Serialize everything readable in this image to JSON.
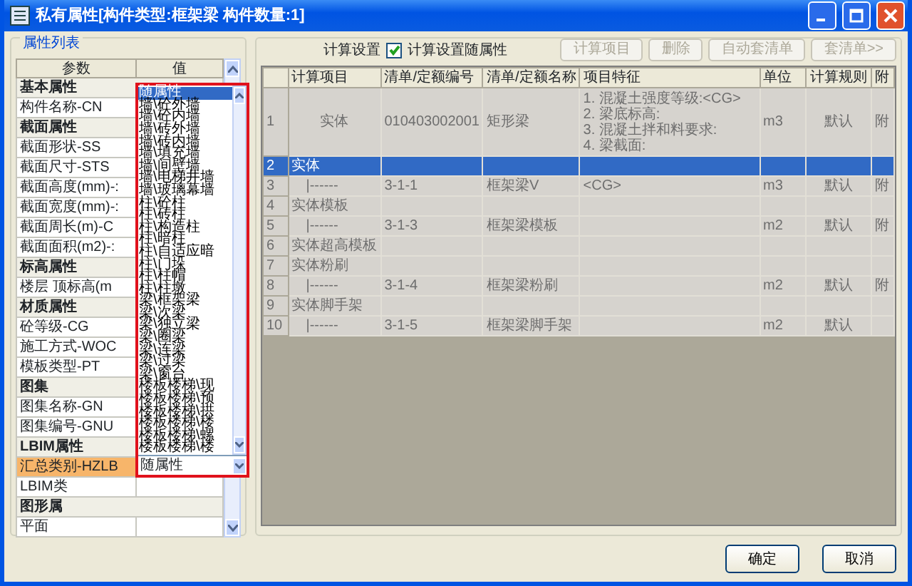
{
  "window": {
    "title": "私有属性[构件类型:框架梁 构件数量:1]"
  },
  "property_list": {
    "title": "属性列表",
    "columns": [
      "参数",
      "值"
    ],
    "rows": [
      {
        "kind": "group",
        "label": "基本属性"
      },
      {
        "kind": "param",
        "label": "构件名称-CN",
        "selected": false
      },
      {
        "kind": "group",
        "label": "截面属性"
      },
      {
        "kind": "param",
        "label": "截面形状-SS",
        "selected": false
      },
      {
        "kind": "param",
        "label": "截面尺寸-STS",
        "selected": false
      },
      {
        "kind": "param",
        "label": "截面高度(mm)-:",
        "selected": false
      },
      {
        "kind": "param",
        "label": "截面宽度(mm)-:",
        "selected": false
      },
      {
        "kind": "param",
        "label": "截面周长(m)-C",
        "selected": false
      },
      {
        "kind": "param",
        "label": "截面面积(m2)-:",
        "selected": false
      },
      {
        "kind": "group",
        "label": "标高属性"
      },
      {
        "kind": "param",
        "label": "楼层 顶标高(m",
        "selected": false
      },
      {
        "kind": "group",
        "label": "材质属性"
      },
      {
        "kind": "param",
        "label": "砼等级-CG",
        "selected": false
      },
      {
        "kind": "param",
        "label": "施工方式-WOC",
        "selected": false
      },
      {
        "kind": "param",
        "label": "模板类型-PT",
        "selected": false
      },
      {
        "kind": "group",
        "label": "图集"
      },
      {
        "kind": "param",
        "label": "图集名称-GN",
        "selected": false
      },
      {
        "kind": "param",
        "label": "图集编号-GNU",
        "selected": false
      },
      {
        "kind": "group",
        "label": "LBIM属性"
      },
      {
        "kind": "param",
        "label": "汇总类别-HZLB",
        "selected": true,
        "dropdown": true
      },
      {
        "kind": "param",
        "label": "LBIM类",
        "selected": false
      },
      {
        "kind": "group",
        "label": "图形属"
      },
      {
        "kind": "param",
        "label": "平面",
        "selected": false
      }
    ],
    "dropdown": {
      "value": "随属性",
      "options": [
        {
          "label": "随属性",
          "selected": true
        },
        {
          "label": "墙\\砼外墙",
          "selected": false
        },
        {
          "label": "墙\\砼内墙",
          "selected": false
        },
        {
          "label": "墙\\砖外墙",
          "selected": false
        },
        {
          "label": "墙\\砖内墙",
          "selected": false
        },
        {
          "label": "墙\\填充墙",
          "selected": false
        },
        {
          "label": "墙\\间壁墙",
          "selected": false
        },
        {
          "label": "墙\\电梯井墙",
          "selected": false
        },
        {
          "label": "墙\\玻璃幕墙",
          "selected": false
        },
        {
          "label": "柱\\砼柱",
          "selected": false
        },
        {
          "label": "柱\\砖柱",
          "selected": false
        },
        {
          "label": "柱\\构造柱",
          "selected": false
        },
        {
          "label": "柱\\暗柱",
          "selected": false
        },
        {
          "label": "柱\\自适应暗",
          "selected": false
        },
        {
          "label": "柱\\门垛",
          "selected": false
        },
        {
          "label": "柱\\柱帽",
          "selected": false
        },
        {
          "label": "柱\\柱墩",
          "selected": false
        },
        {
          "label": "梁\\框架梁",
          "selected": false
        },
        {
          "label": "梁\\次梁",
          "selected": false
        },
        {
          "label": "梁\\独立梁",
          "selected": false
        },
        {
          "label": "梁\\圈梁",
          "selected": false
        },
        {
          "label": "梁\\连梁",
          "selected": false
        },
        {
          "label": "梁\\过梁",
          "selected": false
        },
        {
          "label": "梁\\窗台",
          "selected": false
        },
        {
          "label": "楼板楼梯\\现",
          "selected": false
        },
        {
          "label": "楼板楼梯\\预",
          "selected": false
        },
        {
          "label": "楼板楼梯\\拱",
          "selected": false
        },
        {
          "label": "楼板楼梯\\楼",
          "selected": false
        },
        {
          "label": "楼板楼梯\\螺",
          "selected": false
        },
        {
          "label": "楼板楼梯\\楼",
          "selected": false
        }
      ]
    }
  },
  "calc_settings": {
    "title": "计算设置",
    "follow_checkbox": {
      "label": "计算设置随属性",
      "checked": true
    },
    "buttons": [
      {
        "label": "计算项目",
        "disabled": true
      },
      {
        "label": "删除",
        "disabled": true
      },
      {
        "label": "自动套清单",
        "disabled": true
      },
      {
        "label": "套清单>>",
        "disabled": true
      }
    ],
    "table": {
      "columns": [
        "计算项目",
        "清单/定额编号",
        "清单/定额名称",
        "项目特征",
        "单位",
        "计算规则",
        "附"
      ],
      "rows": [
        {
          "index": "1",
          "selected": false,
          "disabled": true,
          "cells": [
            "实体",
            "010403002001",
            "矩形梁",
            "1. 混凝土强度等级:<CG>\n2. 梁底标高:\n3. 混凝土拌和料要求:\n4. 梁截面:",
            "m3",
            "默认",
            "附"
          ]
        },
        {
          "index": "2",
          "selected": true,
          "disabled": false,
          "cells": [
            "实体",
            "",
            "",
            "",
            "",
            "",
            ""
          ]
        },
        {
          "index": "3",
          "selected": false,
          "disabled": true,
          "cells": [
            "|------",
            "3-1-1",
            "框架梁V",
            "<CG>",
            "m3",
            "默认",
            "附"
          ]
        },
        {
          "index": "4",
          "selected": false,
          "disabled": true,
          "cells": [
            "实体模板",
            "",
            "",
            "",
            "",
            "",
            ""
          ]
        },
        {
          "index": "5",
          "selected": false,
          "disabled": true,
          "cells": [
            "|------",
            "3-1-3",
            "框架梁模板",
            "",
            "m2",
            "默认",
            "附"
          ]
        },
        {
          "index": "6",
          "selected": false,
          "disabled": true,
          "cells": [
            "实体超高模板",
            "",
            "",
            "",
            "",
            "",
            ""
          ]
        },
        {
          "index": "7",
          "selected": false,
          "disabled": true,
          "cells": [
            "实体粉刷",
            "",
            "",
            "",
            "",
            "",
            ""
          ]
        },
        {
          "index": "8",
          "selected": false,
          "disabled": true,
          "cells": [
            "|------",
            "3-1-4",
            "框架梁粉刷",
            "",
            "m2",
            "默认",
            "附"
          ]
        },
        {
          "index": "9",
          "selected": false,
          "disabled": true,
          "cells": [
            "实体脚手架",
            "",
            "",
            "",
            "",
            "",
            ""
          ]
        },
        {
          "index": "10",
          "selected": false,
          "disabled": true,
          "cells": [
            "|------",
            "3-1-5",
            "框架梁脚手架",
            "",
            "m2",
            "默认",
            ""
          ]
        }
      ]
    }
  },
  "buttons": [
    {
      "label": "确定"
    },
    {
      "label": "取消"
    }
  ]
}
